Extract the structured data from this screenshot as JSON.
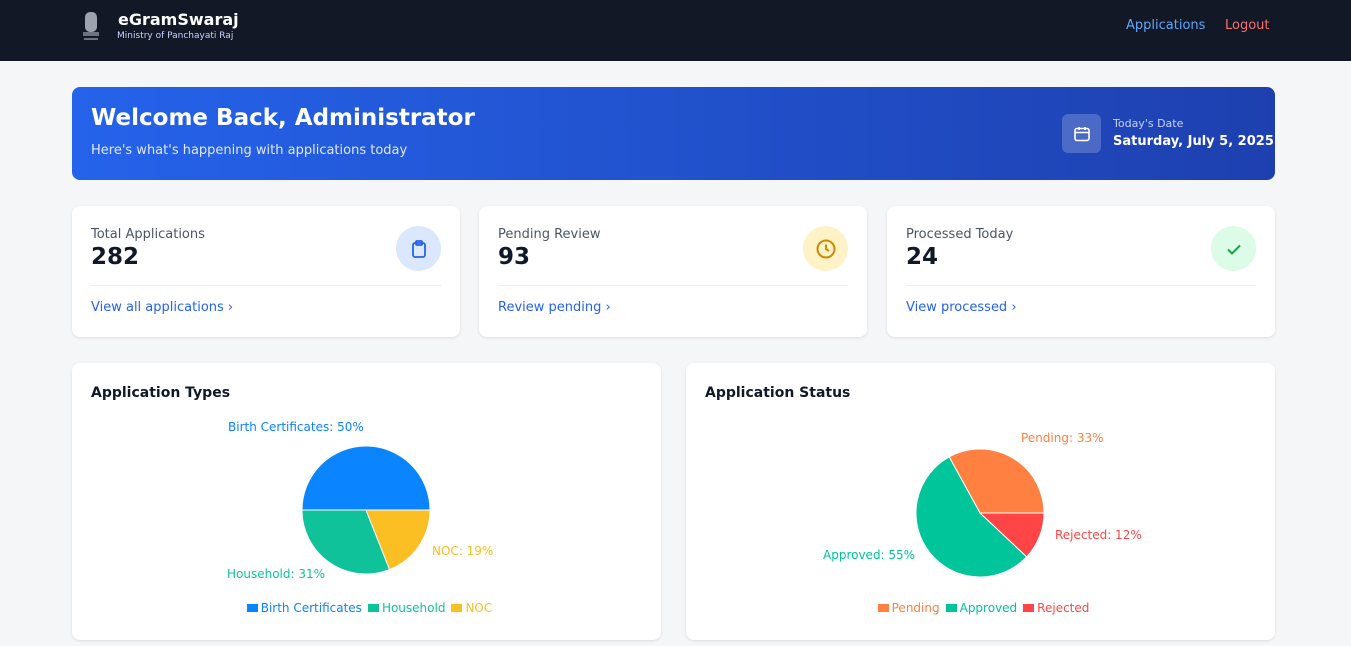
{
  "nav": {
    "brand": "eGramSwaraj",
    "subtitle": "Ministry of Panchayati Raj",
    "links": [
      "Applications",
      "Logout"
    ]
  },
  "hero": {
    "title": "Welcome Back, Administrator",
    "subtitle": "Here's what's happening with applications today",
    "date_label": "Today's Date",
    "date_value": "Saturday, July 5, 2025"
  },
  "stats": [
    {
      "label": "Total Applications",
      "value": "282",
      "link": "View all applications ›",
      "icon": "clipboard-icon"
    },
    {
      "label": "Pending Review",
      "value": "93",
      "link": "Review pending ›",
      "icon": "clock-icon"
    },
    {
      "label": "Processed Today",
      "value": "24",
      "link": "View processed ›",
      "icon": "check-icon"
    }
  ],
  "chart_data": [
    {
      "type": "pie",
      "title": "Application Types",
      "categories": [
        "Birth Certificates",
        "Household",
        "NOC"
      ],
      "values": [
        50,
        31,
        19
      ],
      "labels": [
        "Birth Certificates: 50%",
        "Household: 31%",
        "NOC: 19%"
      ],
      "colors": [
        "#0a84ff",
        "#10c29a",
        "#fbbf24"
      ],
      "legend": "bottom"
    },
    {
      "type": "pie",
      "title": "Application Status",
      "categories": [
        "Pending",
        "Approved",
        "Rejected"
      ],
      "values": [
        33,
        55,
        12
      ],
      "labels": [
        "Pending: 33%",
        "Approved: 55%",
        "Rejected: 12%"
      ],
      "colors": [
        "#ff8040",
        "#00c49a",
        "#ff4545"
      ],
      "legend": "bottom"
    }
  ]
}
